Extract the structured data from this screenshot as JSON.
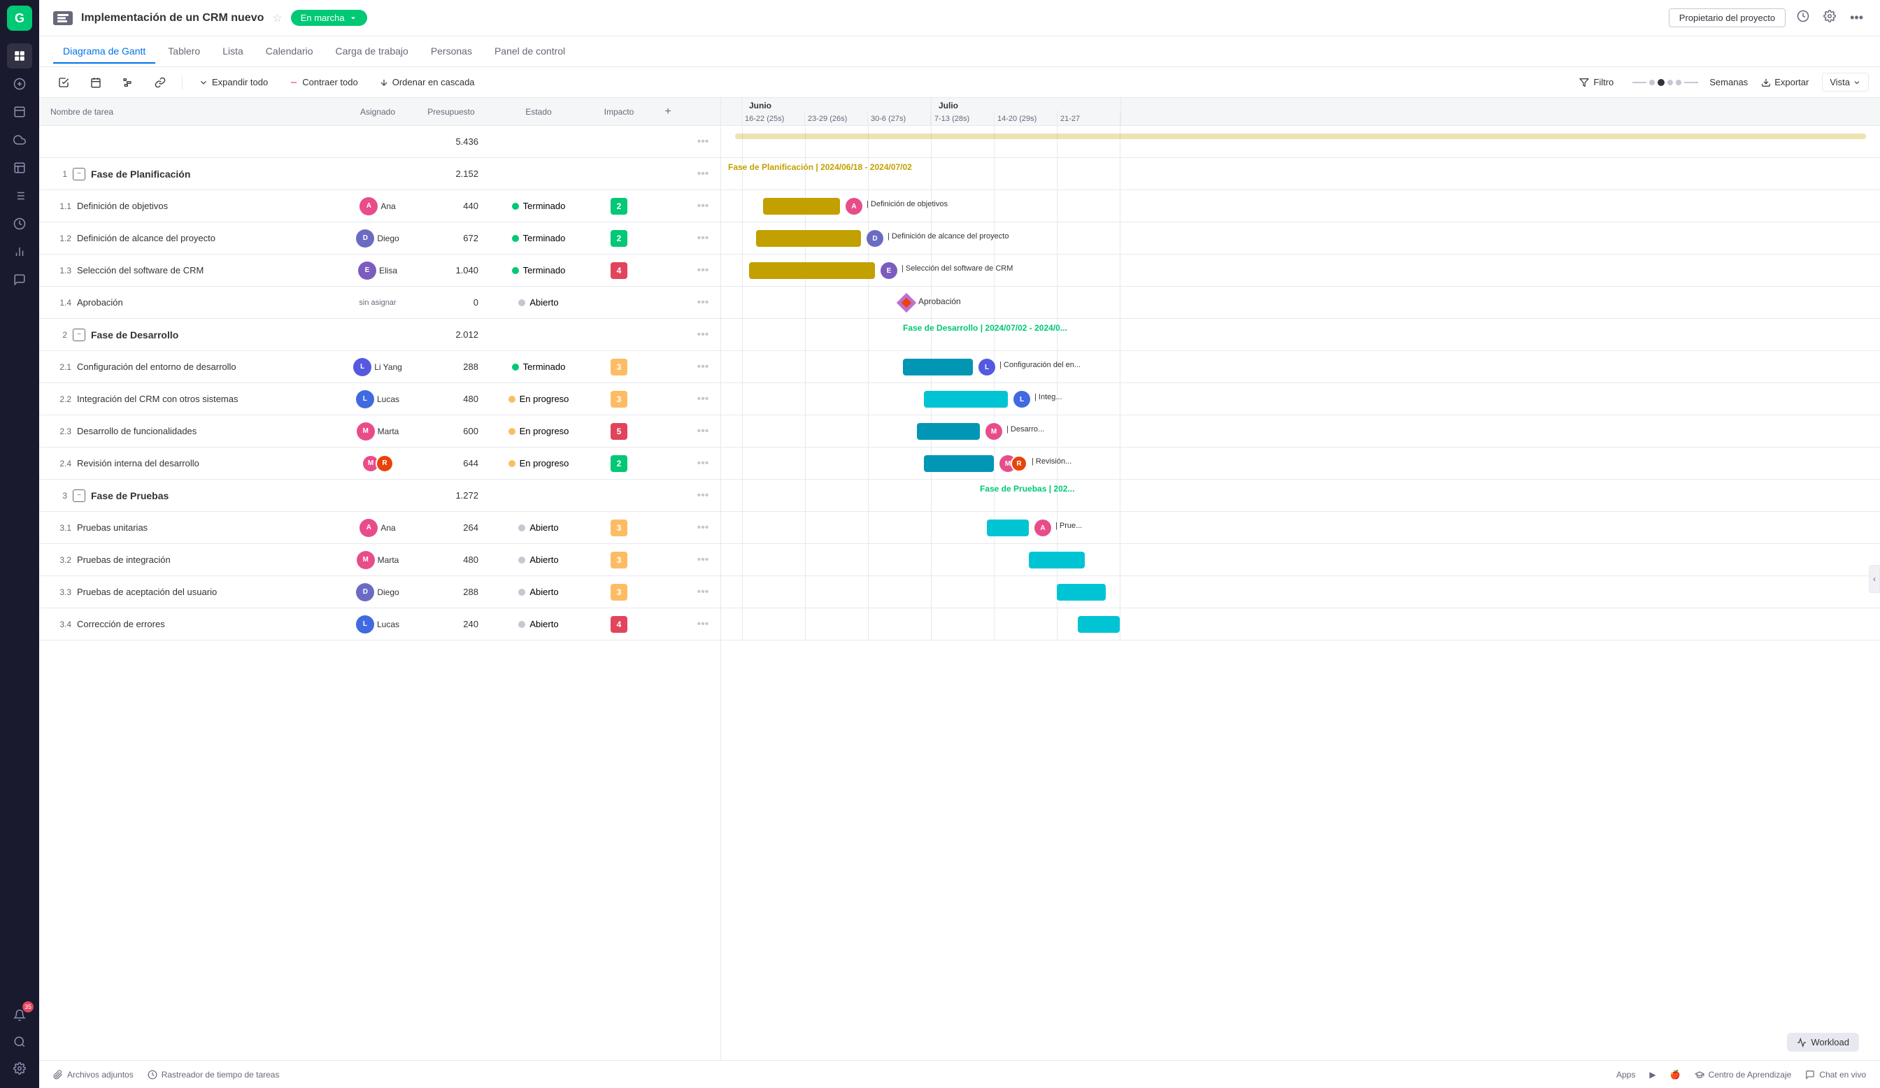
{
  "app": {
    "logo": "G",
    "project_title": "Implementación de un CRM nuevo",
    "status": "En marcha",
    "owner_btn": "Propietario del proyecto"
  },
  "nav_tabs": [
    {
      "label": "Diagrama de Gantt",
      "active": true
    },
    {
      "label": "Tablero",
      "active": false
    },
    {
      "label": "Lista",
      "active": false
    },
    {
      "label": "Calendario",
      "active": false
    },
    {
      "label": "Carga de trabajo",
      "active": false
    },
    {
      "label": "Personas",
      "active": false
    },
    {
      "label": "Panel de control",
      "active": false
    }
  ],
  "toolbar": {
    "expand_all": "Expandir todo",
    "collapse_all": "Contraer todo",
    "cascade": "Ordenar en cascada",
    "filter": "Filtro",
    "weeks": "Semanas",
    "export": "Exportar",
    "view": "Vista"
  },
  "table": {
    "columns": {
      "task": "Nombre de tarea",
      "assigned": "Asignado",
      "budget": "Presupuesto",
      "status": "Estado",
      "impact": "Impacto"
    },
    "empty_row_budget": "5.436",
    "rows": [
      {
        "id": "1",
        "type": "group",
        "name": "Fase de Planificación",
        "budget": "2.152",
        "is_group": true
      },
      {
        "id": "1.1",
        "type": "task",
        "name": "Definición de objetivos",
        "assigned": "Ana",
        "avatar_color": "#e84d8a",
        "budget": "440",
        "status": "Terminado",
        "status_color": "#00c875",
        "impact": "2",
        "impact_color": "#00c875"
      },
      {
        "id": "1.2",
        "type": "task",
        "name": "Definición de alcance del proyecto",
        "assigned": "Diego",
        "avatar_color": "#6b6bc4",
        "budget": "672",
        "status": "Terminado",
        "status_color": "#00c875",
        "impact": "2",
        "impact_color": "#00c875"
      },
      {
        "id": "1.3",
        "type": "task",
        "name": "Selección del software de CRM",
        "assigned": "Elisa",
        "avatar_color": "#7c5cbf",
        "budget": "1.040",
        "status": "Terminado",
        "status_color": "#00c875",
        "impact": "4",
        "impact_color": "#e2445c"
      },
      {
        "id": "1.4",
        "type": "task",
        "name": "Aprobación",
        "assigned": "",
        "assigned_text": "sin asignar",
        "budget": "0",
        "status": "Abierto",
        "status_color": "#c5c7d4",
        "impact": "",
        "impact_color": ""
      },
      {
        "id": "2",
        "type": "group",
        "name": "Fase de Desarrollo",
        "budget": "2.012",
        "is_group": true
      },
      {
        "id": "2.1",
        "type": "task",
        "name": "Configuración del entorno de desarrollo",
        "assigned": "Li Yang",
        "avatar_color": "#5559df",
        "budget": "288",
        "status": "Terminado",
        "status_color": "#00c875",
        "impact": "3",
        "impact_color": "#fdbc64"
      },
      {
        "id": "2.2",
        "type": "task",
        "name": "Integración del CRM con otros sistemas",
        "assigned": "Lucas",
        "avatar_color": "#4169e1",
        "budget": "480",
        "status": "En progreso",
        "status_color": "#fdbc64",
        "impact": "3",
        "impact_color": "#fdbc64"
      },
      {
        "id": "2.3",
        "type": "task",
        "name": "Desarrollo de funcionalidades",
        "assigned": "Marta",
        "avatar_color": "#e84d8a",
        "budget": "600",
        "status": "En progreso",
        "status_color": "#fdbc64",
        "impact": "5",
        "impact_color": "#e2445c"
      },
      {
        "id": "2.4",
        "type": "task",
        "name": "Revisión interna del desarrollo",
        "assigned": "multi",
        "budget": "644",
        "status": "En progreso",
        "status_color": "#fdbc64",
        "impact": "2",
        "impact_color": "#00c875"
      },
      {
        "id": "3",
        "type": "group",
        "name": "Fase de Pruebas",
        "budget": "1.272",
        "is_group": true
      },
      {
        "id": "3.1",
        "type": "task",
        "name": "Pruebas unitarias",
        "assigned": "Ana",
        "avatar_color": "#e84d8a",
        "budget": "264",
        "status": "Abierto",
        "status_color": "#c5c7d4",
        "impact": "3",
        "impact_color": "#fdbc64"
      },
      {
        "id": "3.2",
        "type": "task",
        "name": "Pruebas de integración",
        "assigned": "Marta",
        "avatar_color": "#e84d8a",
        "budget": "480",
        "status": "Abierto",
        "status_color": "#c5c7d4",
        "impact": "3",
        "impact_color": "#fdbc64"
      },
      {
        "id": "3.3",
        "type": "task",
        "name": "Pruebas de aceptación del usuario",
        "assigned": "Diego",
        "avatar_color": "#6b6bc4",
        "budget": "288",
        "status": "Abierto",
        "status_color": "#c5c7d4",
        "impact": "3",
        "impact_color": "#fdbc64"
      },
      {
        "id": "3.4",
        "type": "task",
        "name": "Corrección de errores",
        "assigned": "Lucas",
        "avatar_color": "#4169e1",
        "budget": "240",
        "status": "Abierto",
        "status_color": "#c5c7d4",
        "impact": "4",
        "impact_color": "#e2445c"
      }
    ]
  },
  "gantt": {
    "months": [
      {
        "label": "Junio",
        "weeks": [
          "16-22 (25s)",
          "23-29 (26s)",
          "30-6 (27s)"
        ]
      },
      {
        "label": "Julio",
        "weeks": [
          "7-13 (28s)",
          "14-20 (29s)",
          "21-27"
        ]
      }
    ],
    "phases": [
      {
        "label": "Fase de Planificación | 2024/06/18 - 2024/07/02",
        "color": "#c2a000"
      },
      {
        "label": "Fase de Desarrollo | 2024/07/02 - 2024/0...",
        "color": "#00c875"
      },
      {
        "label": "Fase de Pruebas | 202...",
        "color": "#00c875"
      }
    ]
  },
  "bottom": {
    "attachments": "Archivos adjuntos",
    "time_tracker": "Rastreador de tiempo de tareas",
    "apps": "Apps",
    "learning": "Centro de Aprendizaje",
    "chat": "Chat en vivo"
  },
  "workload_btn": "Workload",
  "sidebar_icons": [
    "☰",
    "＋",
    "⊡",
    "☁",
    "◫",
    "≡",
    "◷",
    "▦",
    "💬"
  ],
  "notification_count": "35"
}
